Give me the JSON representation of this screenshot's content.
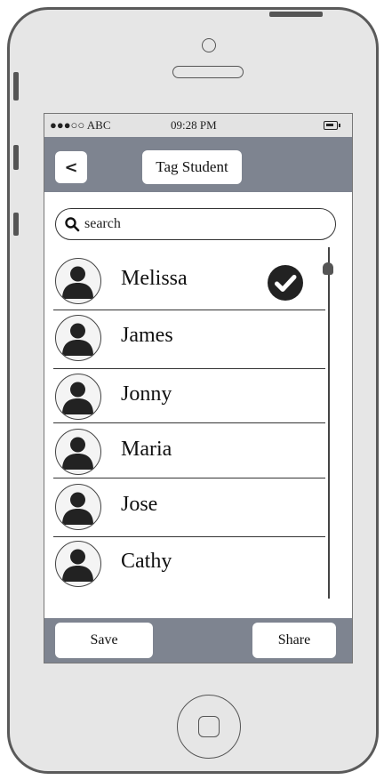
{
  "status_bar": {
    "carrier": "●●●○○ ABC",
    "time": "09:28 PM"
  },
  "nav": {
    "back_icon": "chevron-left-icon",
    "back_glyph": "<",
    "title": "Tag Student"
  },
  "search": {
    "placeholder": "search"
  },
  "students": [
    {
      "name": "Melissa",
      "selected": true
    },
    {
      "name": "James",
      "selected": false
    },
    {
      "name": "Jonny",
      "selected": false
    },
    {
      "name": "Maria",
      "selected": false
    },
    {
      "name": "Jose",
      "selected": false
    },
    {
      "name": "Cathy",
      "selected": false
    }
  ],
  "toolbar": {
    "save_label": "Save",
    "share_label": "Share"
  },
  "colors": {
    "bar": "#7e8490",
    "status_bg": "#e3e3e3",
    "shell": "#e6e6e6"
  }
}
